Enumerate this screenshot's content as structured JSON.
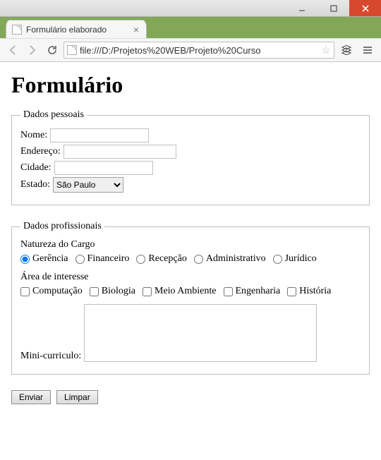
{
  "window": {
    "tab_title": "Formulário elaborado",
    "url": "file:///D:/Projetos%20WEB/Projeto%20Curso"
  },
  "page": {
    "heading": "Formulário"
  },
  "personal": {
    "legend": "Dados pessoais",
    "name_label": "Nome:",
    "name_value": "",
    "address_label": "Endereço:",
    "address_value": "",
    "city_label": "Cidade:",
    "city_value": "",
    "state_label": "Estado:",
    "state_selected": "São Paulo"
  },
  "professional": {
    "legend": "Dados profissionais",
    "role_label": "Natureza do Cargo",
    "roles": [
      {
        "label": "Gerência",
        "checked": true
      },
      {
        "label": "Financeiro",
        "checked": false
      },
      {
        "label": "Recepção",
        "checked": false
      },
      {
        "label": "Administrativo",
        "checked": false
      },
      {
        "label": "Jurídico",
        "checked": false
      }
    ],
    "interest_label": "Área de interesse",
    "interests": [
      {
        "label": "Computação",
        "checked": false
      },
      {
        "label": "Biologia",
        "checked": false
      },
      {
        "label": "Meio Ambiente",
        "checked": false
      },
      {
        "label": "Engenharia",
        "checked": false
      },
      {
        "label": "História",
        "checked": false
      }
    ],
    "cv_label": "Mini-curriculo:",
    "cv_value": ""
  },
  "buttons": {
    "submit": "Enviar",
    "reset": "Limpar"
  }
}
